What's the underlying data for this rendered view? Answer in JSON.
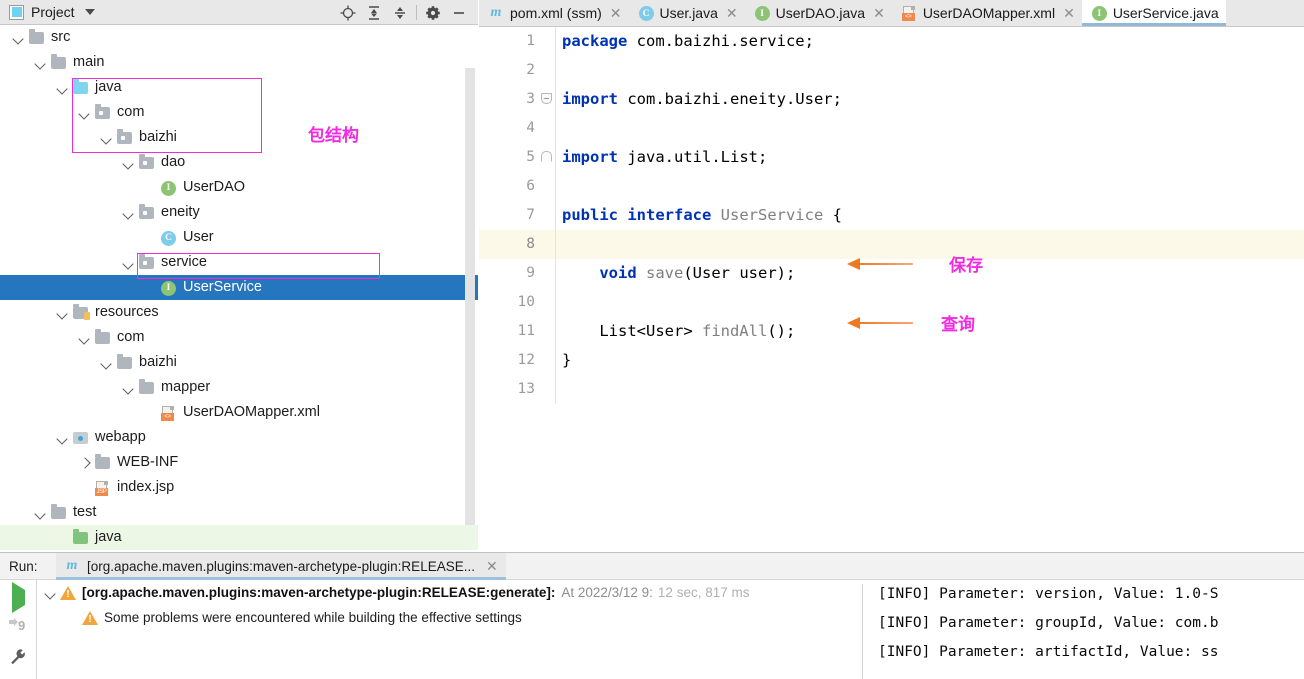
{
  "project_panel": {
    "title": "Project",
    "icons": [
      "project-window-icon",
      "chevron-down-icon",
      "locate-icon",
      "expand-all-icon",
      "collapse-all-icon",
      "gear-icon",
      "minimize-icon"
    ],
    "tree": [
      {
        "label": "src",
        "indent": 0,
        "twisty": "down",
        "icon": "folder-gray",
        "state": "normal"
      },
      {
        "label": "main",
        "indent": 1,
        "twisty": "down",
        "icon": "folder-gray",
        "state": "normal"
      },
      {
        "label": "java",
        "indent": 2,
        "twisty": "down",
        "icon": "folder-blue",
        "state": "normal"
      },
      {
        "label": "com",
        "indent": 3,
        "twisty": "down",
        "icon": "folder-package",
        "state": "normal"
      },
      {
        "label": "baizhi",
        "indent": 4,
        "twisty": "down",
        "icon": "folder-package",
        "state": "normal"
      },
      {
        "label": "dao",
        "indent": 5,
        "twisty": "down",
        "icon": "folder-package",
        "state": "normal"
      },
      {
        "label": "UserDAO",
        "indent": 6,
        "twisty": "none",
        "icon": "interface-badge",
        "state": "normal"
      },
      {
        "label": "eneity",
        "indent": 5,
        "twisty": "down",
        "icon": "folder-package",
        "state": "normal"
      },
      {
        "label": "User",
        "indent": 6,
        "twisty": "none",
        "icon": "class-badge",
        "state": "normal"
      },
      {
        "label": "service",
        "indent": 5,
        "twisty": "down",
        "icon": "folder-package",
        "state": "normal"
      },
      {
        "label": "UserService",
        "indent": 6,
        "twisty": "none",
        "icon": "interface-badge",
        "state": "selected"
      },
      {
        "label": "resources",
        "indent": 2,
        "twisty": "down",
        "icon": "folder-resources",
        "state": "normal"
      },
      {
        "label": "com",
        "indent": 3,
        "twisty": "down",
        "icon": "folder-gray",
        "state": "normal"
      },
      {
        "label": "baizhi",
        "indent": 4,
        "twisty": "down",
        "icon": "folder-gray",
        "state": "normal"
      },
      {
        "label": "mapper",
        "indent": 5,
        "twisty": "down",
        "icon": "folder-gray",
        "state": "normal"
      },
      {
        "label": "UserDAOMapper.xml",
        "indent": 6,
        "twisty": "none",
        "icon": "xml-file",
        "state": "normal"
      },
      {
        "label": "webapp",
        "indent": 2,
        "twisty": "down",
        "icon": "folder-webapp",
        "state": "normal"
      },
      {
        "label": "WEB-INF",
        "indent": 3,
        "twisty": "right",
        "icon": "folder-gray",
        "state": "normal"
      },
      {
        "label": "index.jsp",
        "indent": 3,
        "twisty": "none",
        "icon": "jsp-file",
        "state": "normal"
      },
      {
        "label": "test",
        "indent": 1,
        "twisty": "down",
        "icon": "folder-gray",
        "state": "normal"
      },
      {
        "label": "java",
        "indent": 2,
        "twisty": "none",
        "icon": "folder-green",
        "state": "green"
      }
    ],
    "annotations": [
      {
        "text": "包结构",
        "color": "#f12ce0"
      }
    ]
  },
  "editor": {
    "tabs": [
      {
        "label": "pom.xml (ssm)",
        "icon": "maven-icon",
        "active": false,
        "closable": true
      },
      {
        "label": "User.java",
        "icon": "class-badge",
        "active": false,
        "closable": true
      },
      {
        "label": "UserDAO.java",
        "icon": "interface-badge",
        "active": false,
        "closable": true
      },
      {
        "label": "UserDAOMapper.xml",
        "icon": "xml-file",
        "active": false,
        "closable": true
      },
      {
        "label": "UserService.java",
        "icon": "interface-badge",
        "active": true,
        "closable": false
      }
    ],
    "lines": [
      {
        "no": "1",
        "fold": "none",
        "caret": false,
        "tokens": [
          {
            "t": "package",
            "c": "kw"
          },
          {
            "t": " com.baizhi.service;",
            "c": "plain"
          }
        ]
      },
      {
        "no": "2",
        "fold": "none",
        "caret": false,
        "tokens": []
      },
      {
        "no": "3",
        "fold": "start",
        "caret": false,
        "tokens": [
          {
            "t": "import",
            "c": "kw"
          },
          {
            "t": " com.baizhi.eneity.User;",
            "c": "plain"
          }
        ]
      },
      {
        "no": "4",
        "fold": "none",
        "caret": false,
        "tokens": []
      },
      {
        "no": "5",
        "fold": "end",
        "caret": false,
        "tokens": [
          {
            "t": "import",
            "c": "kw"
          },
          {
            "t": " java.util.List;",
            "c": "plain"
          }
        ]
      },
      {
        "no": "6",
        "fold": "none",
        "caret": false,
        "tokens": []
      },
      {
        "no": "7",
        "fold": "none",
        "caret": false,
        "tokens": [
          {
            "t": "public interface",
            "c": "kw"
          },
          {
            "t": " ",
            "c": "plain"
          },
          {
            "t": "UserService",
            "c": "typ"
          },
          {
            "t": " {",
            "c": "plain"
          }
        ]
      },
      {
        "no": "8",
        "fold": "none",
        "caret": true,
        "tokens": []
      },
      {
        "no": "9",
        "fold": "none",
        "caret": false,
        "tokens": [
          {
            "t": "    ",
            "c": "plain"
          },
          {
            "t": "void",
            "c": "kw"
          },
          {
            "t": " ",
            "c": "plain"
          },
          {
            "t": "save",
            "c": "typ"
          },
          {
            "t": "(User user);",
            "c": "plain"
          }
        ]
      },
      {
        "no": "10",
        "fold": "none",
        "caret": false,
        "tokens": []
      },
      {
        "no": "11",
        "fold": "none",
        "caret": false,
        "tokens": [
          {
            "t": "    List<User> ",
            "c": "plain"
          },
          {
            "t": "findAll",
            "c": "typ"
          },
          {
            "t": "();",
            "c": "plain"
          }
        ]
      },
      {
        "no": "12",
        "fold": "none",
        "caret": false,
        "tokens": [
          {
            "t": "}",
            "c": "plain"
          }
        ]
      },
      {
        "no": "13",
        "fold": "none",
        "caret": false,
        "tokens": []
      }
    ],
    "annotations": [
      {
        "text": "保存",
        "color": "#f12ce0",
        "arrow": "left-arrow-icon"
      },
      {
        "text": "查询",
        "color": "#f12ce0",
        "arrow": "left-arrow-icon"
      }
    ]
  },
  "run_panel": {
    "label": "Run:",
    "tab": {
      "label": "[org.apache.maven.plugins:maven-archetype-plugin:RELEASE...",
      "icon": "maven-icon"
    },
    "side_icons": [
      "run-icon",
      "rerun-9-icon",
      "wrench-icon"
    ],
    "tree": [
      {
        "text": "[org.apache.maven.plugins:maven-archetype-plugin:RELEASE:generate]:",
        "suffix_time": "At 2022/3/12 9:",
        "suffix_duration": "12 sec, 817 ms",
        "twisty": "down",
        "icon": "warning-icon",
        "indent": 0
      },
      {
        "text": "Some problems were encountered while building the effective settings",
        "suffix_time": "",
        "suffix_duration": "",
        "twisty": "none",
        "icon": "warning-icon",
        "indent": 1
      }
    ],
    "console": [
      "[INFO] Parameter: version, Value: 1.0-S",
      "[INFO] Parameter: groupId, Value: com.b",
      "[INFO] Parameter: artifactId, Value: ss"
    ]
  },
  "colors": {
    "selection_blue": "#2675bf",
    "annotation_magenta": "#f12ce0",
    "arrow_orange": "#ef7820",
    "caret_line": "#fcf9e9",
    "green_row": "#ecf7e6",
    "keyword_blue": "#0033b3"
  }
}
